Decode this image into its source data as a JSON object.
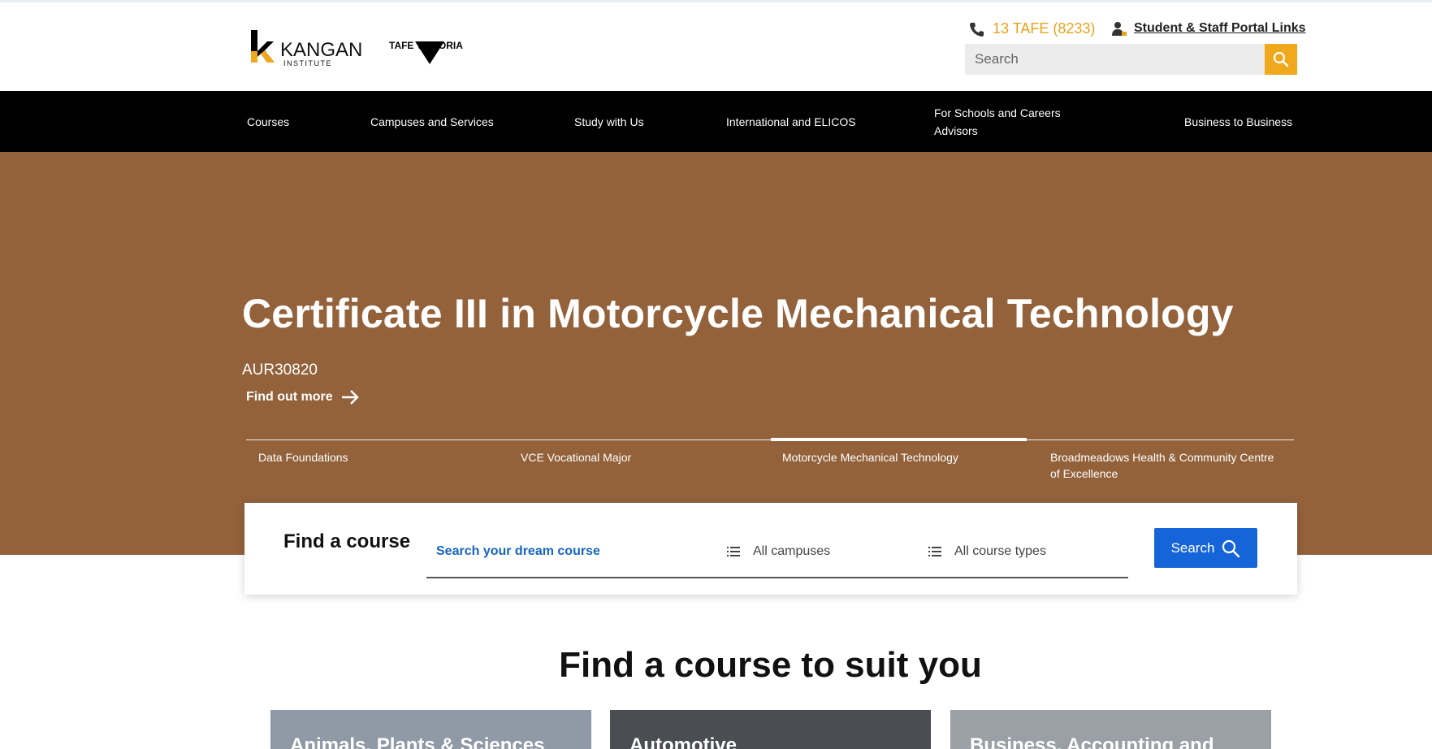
{
  "header": {
    "brand": "KANGAN",
    "brand_sub": "INSTITUTE",
    "tafe_brand": "TAFE VICTORIA",
    "phone": "13 TAFE (8233)",
    "portal_link": "Student & Staff Portal Links",
    "search_placeholder": "Search",
    "accent_color": "#f0a81c"
  },
  "nav": {
    "items": [
      {
        "label": "Courses"
      },
      {
        "label": "Campuses and Services"
      },
      {
        "label": "Study with Us"
      },
      {
        "label": "International and ELICOS"
      },
      {
        "label": "For Schools and Careers Advisors"
      },
      {
        "label": "Business to Business"
      }
    ]
  },
  "hero": {
    "title": "Certificate III in Motorcycle Mechanical Technology",
    "code": "AUR30820",
    "cta": "Find out more",
    "background_color": "#93623b",
    "tabs": [
      {
        "label": "Data Foundations",
        "active": false
      },
      {
        "label": "VCE Vocational Major",
        "active": false
      },
      {
        "label": "Motorcycle Mechanical Technology",
        "active": true
      },
      {
        "label": "Broadmeadows Health & Community Centre of Excellence",
        "active": false
      }
    ]
  },
  "find": {
    "label": "Find a course",
    "search_placeholder": "Search your dream course",
    "campus_select": "All campuses",
    "type_select": "All course types",
    "button": "Search",
    "button_color": "#1565d8"
  },
  "section": {
    "title": "Find a course to suit you"
  },
  "cards": [
    {
      "title": "Animals, Plants & Sciences"
    },
    {
      "title": "Automotive"
    },
    {
      "title": "Business, Accounting and"
    }
  ]
}
